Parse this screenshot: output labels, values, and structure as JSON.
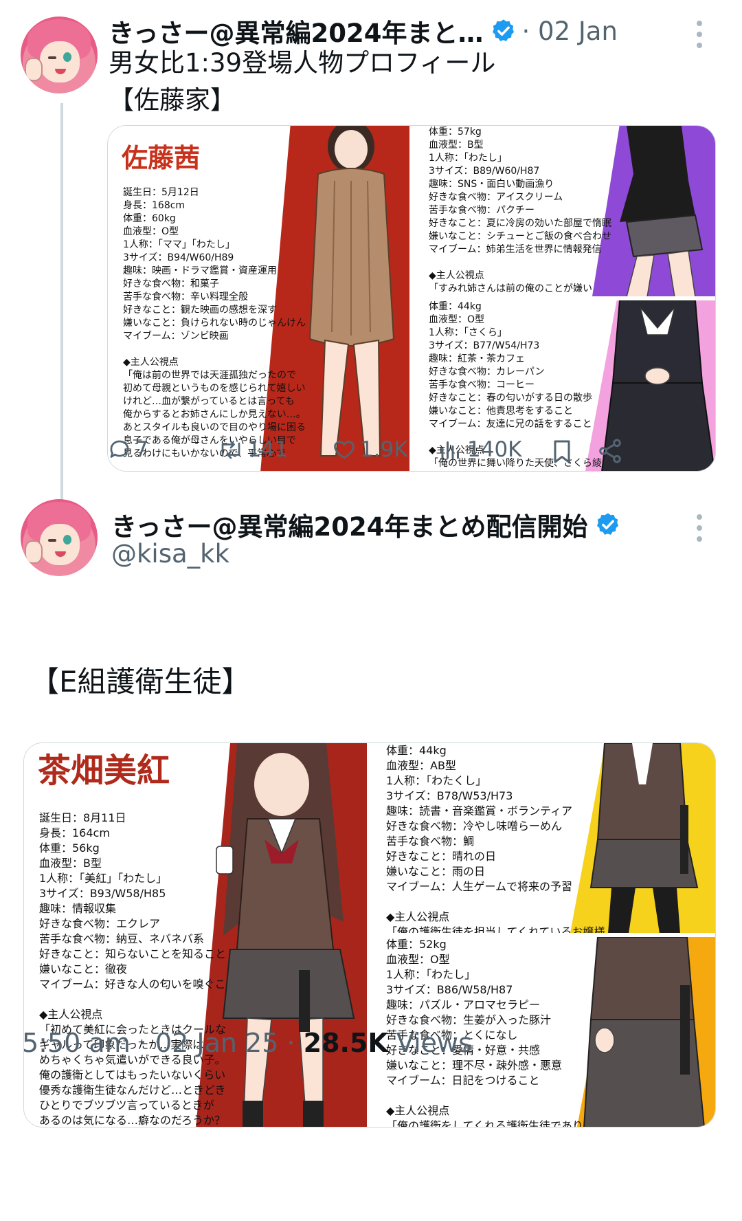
{
  "first_tweet": {
    "display_name": "きっさー@異常編2024年まと…",
    "date": "· 02 Jan",
    "text_line1": "男女比1:39登場人物プロフィール",
    "text_line2": "【佐藤家】",
    "media": {
      "left_panel": {
        "name": "佐藤茜",
        "profile": "誕生日：5月12日\n身長：168cm\n体重：60kg\n血液型：O型\n1人称：「ママ」「わたし」\n3サイズ：B94/W60/H89\n趣味：映画・ドラマ鑑賞・資産運用\n好きな食べ物：和菓子\n苦手な食べ物：辛い料理全般\n好きなこと：観た映画の感想を深す\n嫌いなこと：負けられない時のじゃんけん\nマイブーム：ゾンビ映画\n\n◆主人公視点\n「俺は前の世界では天涯孤独だったので\n初めて母親というものを感じられて嬉しい\nけれど…血が繋がっているとは言っても\n俺からするとお姉さんにしか見えない…。\nあとスタイルも良いので目のやり場に困る\n息子である俺が母さんをいやらしい目で\n見るわけにもいかないので、平常心で"
      },
      "top_right_panel": {
        "profile": "体重：57kg\n血液型：B型\n1人称：「わたし」\n3サイズ：B89/W60/H87\n趣味：SNS・面白い動画漁り\n好きな食べ物：アイスクリーム\n苦手な食べ物：パクチー\n好きなこと：夏に冷房の効いた部屋で惰眠\n嫌いなこと：シチューとご飯の食べ合わせ\nマイブーム：姉弟生活を世界に情報発信\n\n◆主人公視点\n「すみれ姉さんは前の俺のことが嫌い"
      },
      "bottom_right_panel": {
        "profile": "体重：44kg\n血液型：O型\n1人称：「さくら」\n3サイズ：B77/W54/H73\n趣味：紅茶・茶カフェ\n好きな食べ物：カレーパン\n苦手な食べ物：コーヒー\n好きなこと：春の匂いがする日の散歩\n嫌いなこと：他責思考をすること\nマイブーム：友達に兄の話をすること\n\n◆主人公視点\n「俺の世界に舞い降りた天使、さくら綾"
      }
    },
    "actions": {
      "replies": "7",
      "reposts": "141",
      "likes": "1.9K",
      "views": "140K"
    }
  },
  "main_tweet": {
    "display_name": "きっさー@異常編2024年まとめ配信開始",
    "handle": "@kisa_kk",
    "text": "【E組護衛生徒】",
    "media": {
      "left_panel": {
        "name": "茶畑美紅",
        "profile": "誕生日：8月11日\n身長：164cm\n体重：56kg\n血液型：B型\n1人称：「美紅」「わたし」\n3サイズ：B93/W58/H85\n趣味：情報収集\n好きな食べ物：エクレア\n苦手な食べ物：納豆、ネバネバ系\n好きなこと：知らないことを知ること\n嫌いなこと：徹夜\nマイブーム：好きな人の匂いを嗅ぐこと\n\n◆主人公視点\n「初めて美紅に会ったときはクールな\nギャルって印象だったが…実際は\nめちゃくちゃ気遣いができる良い子。\n俺の護衛としてはもったいないくらい\n優秀な護衛生徒なんだけど…ときどき\nひとりでブツブツ言っているときが\nあるのは気になる…癖なのだろうか？"
      },
      "top_right_panel": {
        "profile": "体重：44kg\n血液型：AB型\n1人称：「わたくし」\n3サイズ：B78/W53/H73\n趣味：読書・音楽鑑賞・ボランティア\n好きな食べ物：冷やし味噌らーめん\n苦手な食べ物：鯛\n好きなこと：晴れの日\n嫌いなこと：雨の日\nマイブーム：人生ゲームで将来の予習\n\n◆主人公視点\n「俺の護衛生徒を担当してくれているお嬢様"
      },
      "bottom_right_panel": {
        "profile": "体重：52kg\n血液型：O型\n1人称：「わたし」\n3サイズ：B86/W58/H87\n趣味：パズル・アロマセラピー\n好きな食べ物：生姜が入った豚汁\n苦手な食べ物：とくになし\n好きなこと：愛情・好意・共感\n嫌いなこと：理不尽・疎外感・悪意\nマイブーム：日記をつけること\n\n◆主人公視点\n「俺の護衛をしてくれる護衛生徒であり"
      }
    },
    "timestamp": {
      "time_date": "5:50 am · 02 Jan 25 · ",
      "views_count": "28.5K",
      "views_label": " Views"
    }
  },
  "colors": {
    "accent_blue": "#1d9bf0",
    "secondary_text": "#536471",
    "red_stripe": "#b7281a",
    "purple_stripe": "#8e4ad6",
    "pink_stripe": "#f3a2df",
    "yellow_stripe": "#f6d21c",
    "orange_stripe": "#f5a90e"
  }
}
